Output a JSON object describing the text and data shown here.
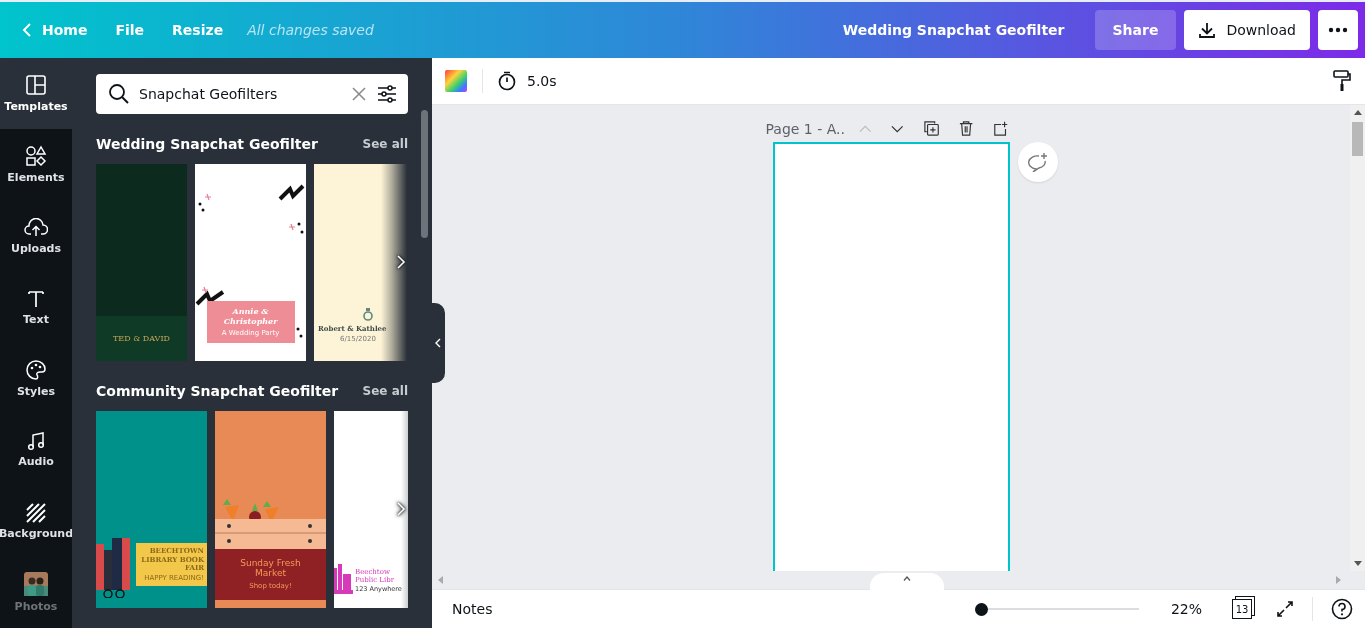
{
  "top_bar": {
    "home": "Home",
    "menu": [
      "File",
      "Resize"
    ],
    "save_status": "All changes saved",
    "title": "Wedding Snapchat Geofilter",
    "share": "Share",
    "download": "Download"
  },
  "sidebar": [
    {
      "kind": "templates",
      "label": "Templates",
      "selected": true
    },
    {
      "kind": "elements",
      "label": "Elements",
      "selected": false
    },
    {
      "kind": "uploads",
      "label": "Uploads",
      "selected": false
    },
    {
      "kind": "text",
      "label": "Text",
      "selected": false
    },
    {
      "kind": "styles",
      "label": "Styles",
      "selected": false
    },
    {
      "kind": "audio",
      "label": "Audio",
      "selected": false
    },
    {
      "kind": "background",
      "label": "Background",
      "selected": false
    },
    {
      "kind": "photos",
      "label": "Photos",
      "selected": false
    }
  ],
  "search": {
    "value": "Snapchat Geofilters"
  },
  "sections": [
    {
      "title": "Wedding Snapchat Geofilter",
      "see_all": "See all",
      "templates": [
        {
          "kind": "green",
          "texts": [
            "TED & DAVID"
          ]
        },
        {
          "kind": "pink",
          "texts": [
            "Annie & Christopher",
            "A Wedding Party"
          ]
        },
        {
          "kind": "cream",
          "texts": [
            "Robert & Kathlee",
            "6/15/2020"
          ]
        }
      ]
    },
    {
      "title": "Community Snapchat Geofilter",
      "see_all": "See all",
      "templates": [
        {
          "kind": "library",
          "texts": [
            "BEECHTOWN LIBRARY BOOK FAIR",
            "HAPPY READING!"
          ]
        },
        {
          "kind": "market",
          "texts": [
            "Sunday Fresh Market",
            "Shop today!"
          ]
        },
        {
          "kind": "public",
          "texts": [
            "Beechtow Public Libr",
            "123 Anywhere"
          ]
        }
      ]
    }
  ],
  "toolbar": {
    "duration": "5.0s"
  },
  "page": {
    "label": "Page 1 - A.."
  },
  "bottom_bar": {
    "notes": "Notes",
    "zoom": {
      "level": 0,
      "reading": "22%"
    },
    "page_count": "13"
  }
}
